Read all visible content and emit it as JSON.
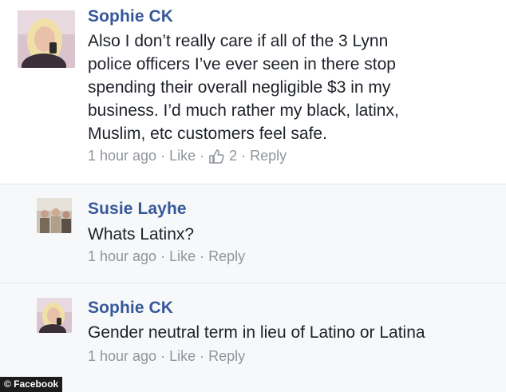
{
  "comments": [
    {
      "author": "Sophie CK",
      "lines": [
        "Also I don’t really care if all of the 3 Lynn",
        "police officers I’ve ever seen in there stop",
        "spending their overall negligible $3 in my",
        "business. I’d much rather my black, latinx,",
        "Muslim, etc customers feel safe."
      ],
      "time": "1 hour ago",
      "like_label": "Like",
      "like_count": "2",
      "reply_label": "Reply",
      "avatar_icon": "profile-photo-blonde-woman"
    },
    {
      "author": "Susie Layhe",
      "lines": [
        "Whats Latinx?"
      ],
      "time": "1 hour ago",
      "like_label": "Like",
      "reply_label": "Reply",
      "avatar_icon": "profile-photo-group"
    },
    {
      "author": "Sophie CK",
      "lines": [
        "Gender neutral term in lieu of Latino or Latina"
      ],
      "time": "1 hour ago",
      "like_label": "Like",
      "reply_label": "Reply",
      "avatar_icon": "profile-photo-blonde-woman"
    }
  ],
  "separator": "·",
  "watermark": "© Facebook",
  "colors": {
    "author": "#365899",
    "meta": "#90949c",
    "text": "#1d2129",
    "reply_bg": "#f7f8fa"
  }
}
